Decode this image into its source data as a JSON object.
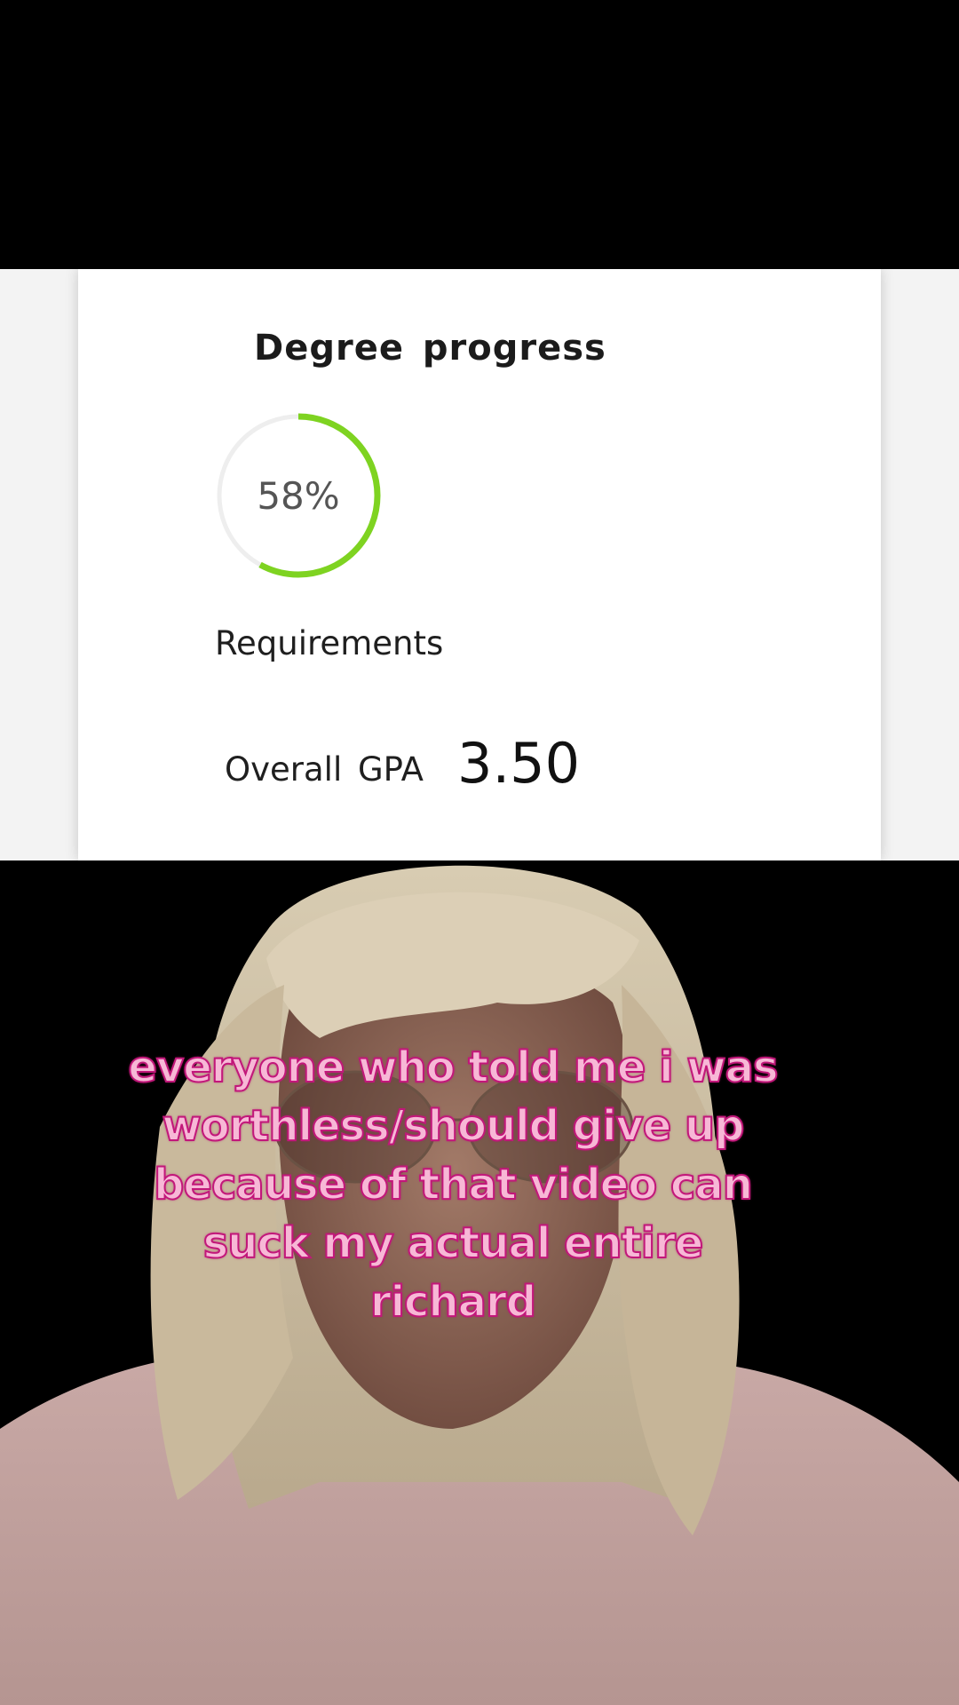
{
  "card": {
    "title": "Degree progress",
    "progress_label": "58%",
    "progress_fraction": 0.58,
    "requirements_label": "Requirements",
    "gpa_label": "Overall GPA",
    "gpa_value": "3.50"
  },
  "colors": {
    "progress_accent": "#7ed321",
    "caption_fill": "#f7b8d6",
    "caption_outline": "#c2177a"
  },
  "caption": {
    "text": "everyone who told me i was worthless/should give up because of that video can suck my actual entire richard"
  }
}
